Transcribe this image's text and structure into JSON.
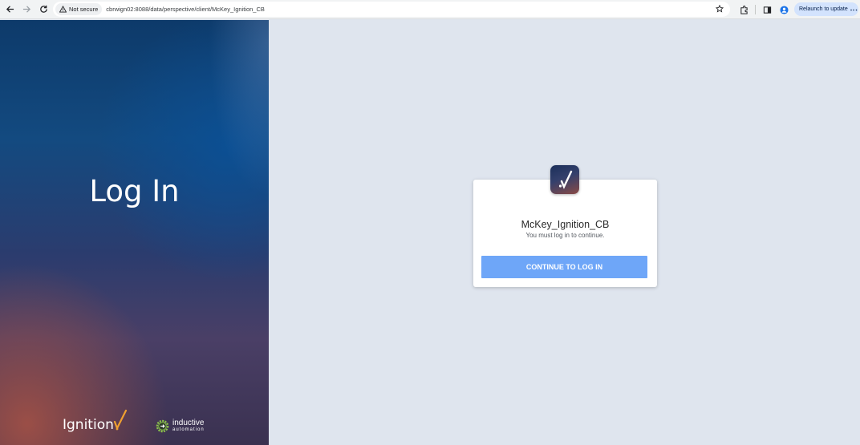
{
  "browser": {
    "security_label": "Not secure",
    "url": "cbrwign02:8088/data/perspective/client/McKey_Ignition_CB",
    "relaunch_label": "Relaunch to update"
  },
  "left_panel": {
    "heading": "Log In",
    "ignition_logo_text": "Ignition",
    "inductive_line1": "inductive",
    "inductive_line2": "automation"
  },
  "login_card": {
    "project_name": "McKey_Ignition_CB",
    "subtitle": "You must log in to continue.",
    "button_label": "CONTINUE TO LOG IN"
  },
  "colors": {
    "button": "#6ea6f8",
    "right_background": "#dfe5ee",
    "card": "#ffffff"
  },
  "icons": [
    "back-arrow-icon",
    "forward-arrow-icon",
    "reload-icon",
    "warning-icon",
    "star-icon",
    "extensions-icon",
    "side-panel-icon",
    "profile-icon",
    "kebab-menu-icon",
    "ignition-app-icon",
    "ignition-logo",
    "inductive-automation-logo"
  ]
}
